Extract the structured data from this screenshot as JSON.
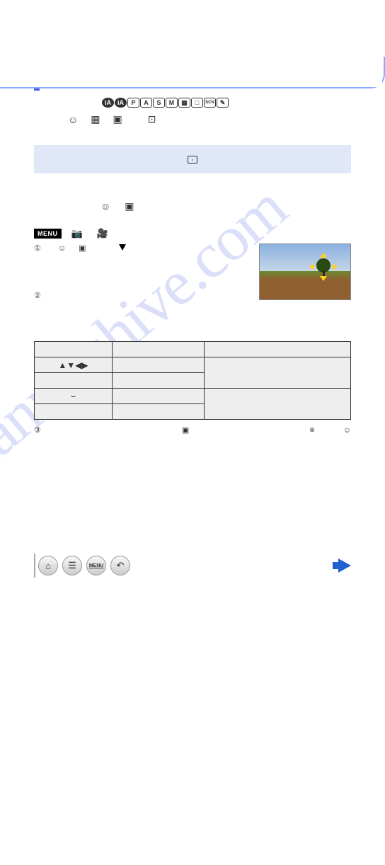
{
  "watermark": "manualshive.com",
  "modes": [
    "iA",
    "iA+",
    "P",
    "A",
    "S",
    "M",
    "C1",
    "C2",
    "SCN",
    "Cr"
  ],
  "af_icons": [
    "face",
    "multi",
    "single",
    "spot"
  ],
  "blue_box_icon": "spot-af",
  "menu": {
    "tag": "MENU",
    "icons": [
      "camera",
      "movie"
    ]
  },
  "step1": {
    "number": "①",
    "down": "▼"
  },
  "step2": {
    "number": "②"
  },
  "table": {
    "rows": [
      {
        "label": ""
      },
      {
        "label": "▲▼◀▶"
      },
      {
        "label": ""
      },
      {
        "label": "dial"
      },
      {
        "label": ""
      }
    ]
  },
  "step3": {
    "number": "③",
    "icon1": "single-af",
    "icon2": "+",
    "icon3": "face"
  },
  "footer": {
    "buttons": [
      "home",
      "list",
      "MENU",
      "back"
    ]
  }
}
